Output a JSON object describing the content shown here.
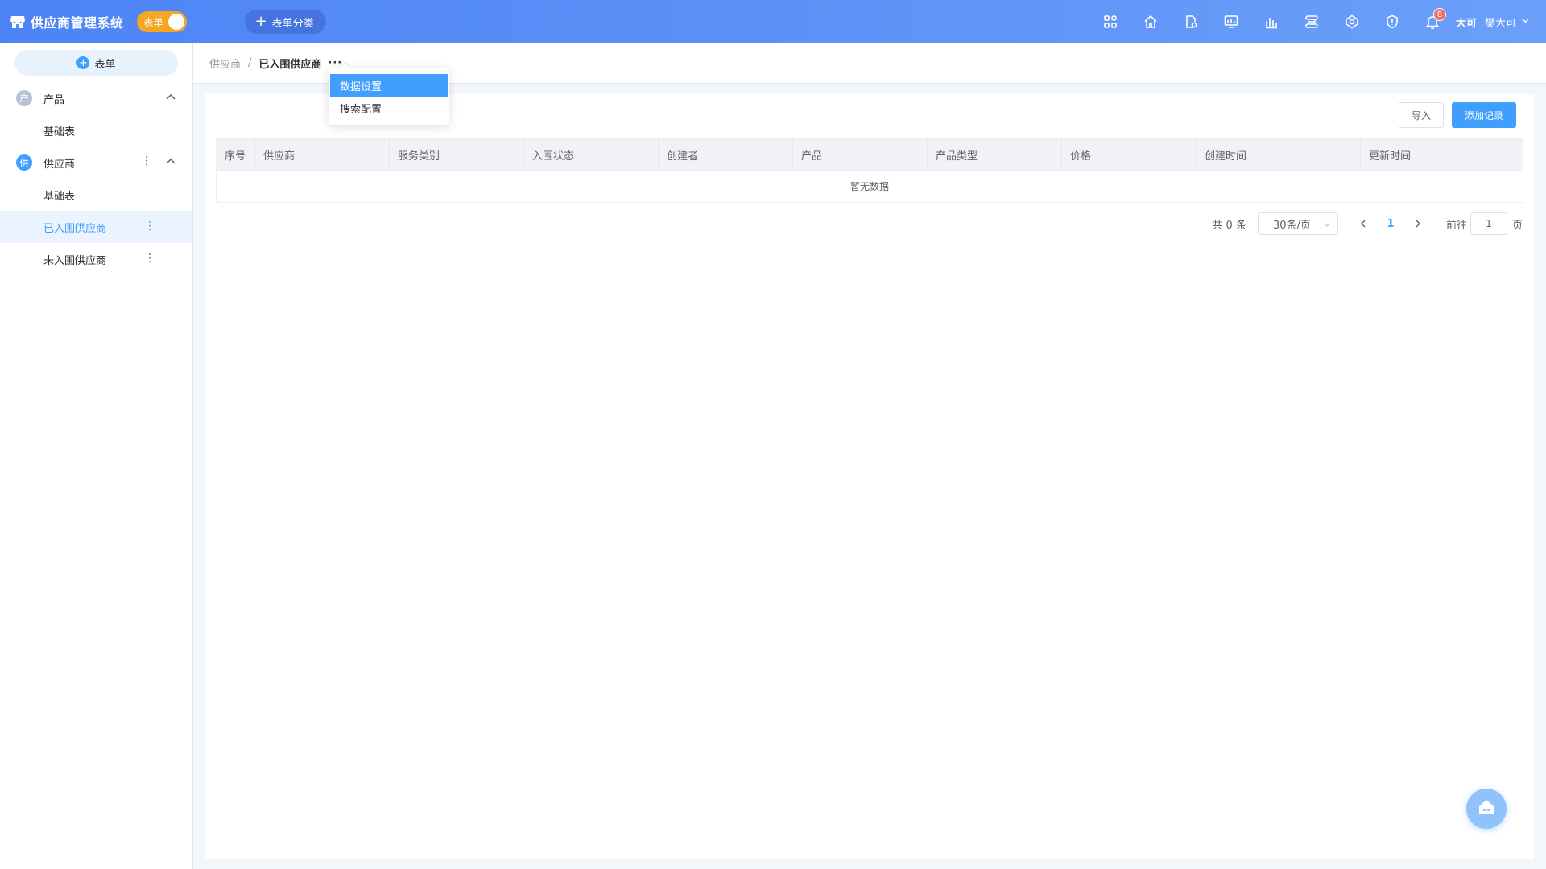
{
  "header": {
    "app_title": "供应商管理系统",
    "mode_toggle_label": "表单",
    "category_button_label": "表单分类",
    "notification_count": "8",
    "user_avatar_text": "大可",
    "user_name": "樊大可",
    "icons": [
      "apps-icon",
      "home-icon",
      "document-settings-icon",
      "dashboard-icon",
      "bar-chart-icon",
      "flow-icon",
      "hub-icon",
      "shield-icon",
      "bell-icon"
    ]
  },
  "sidebar": {
    "new_form_label": "表单",
    "groups": [
      {
        "icon_text": "产",
        "label": "产品",
        "items": [
          {
            "label": "基础表"
          }
        ]
      },
      {
        "icon_text": "供",
        "label": "供应商",
        "items": [
          {
            "label": "基础表"
          },
          {
            "label": "已入围供应商",
            "active": true
          },
          {
            "label": "未入围供应商"
          }
        ]
      }
    ]
  },
  "breadcrumb": {
    "parent": "供应商",
    "separator": "/",
    "current": "已入围供应商",
    "more": "···"
  },
  "dropdown": {
    "items": [
      {
        "label": "数据设置",
        "active": true
      },
      {
        "label": "搜索配置"
      }
    ]
  },
  "toolbar": {
    "import_label": "导入",
    "add_label": "添加记录"
  },
  "table": {
    "columns": [
      "序号",
      "供应商",
      "服务类别",
      "入围状态",
      "创建者",
      "产品",
      "产品类型",
      "价格",
      "创建时间",
      "更新时间"
    ],
    "rows": [],
    "empty_text": "暂无数据"
  },
  "pagination": {
    "total_text": "共 0 条",
    "page_size": "30条/页",
    "current_page": "1",
    "goto_label": "前往",
    "goto_value": "1",
    "goto_unit": "页"
  },
  "colors": {
    "primary": "#409eff",
    "toggle": "#f5a623",
    "badge": "#f56c6c"
  }
}
